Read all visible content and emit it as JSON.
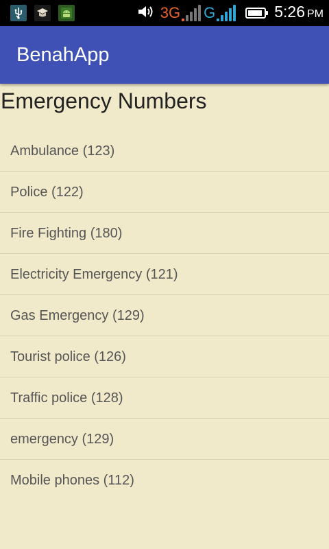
{
  "status_bar": {
    "network_label_1": "3G",
    "network_label_2": "G",
    "time": "5:26",
    "ampm": "PM",
    "icons": [
      "usb-icon",
      "hat-icon",
      "android-icon",
      "volume-icon",
      "signal-icon",
      "battery-icon"
    ]
  },
  "app_bar": {
    "title": "BenahApp"
  },
  "page": {
    "title": "Emergency Numbers"
  },
  "emergency_numbers": [
    {
      "label": "Ambulance (123)"
    },
    {
      "label": "Police (122)"
    },
    {
      "label": "Fire Fighting (180)"
    },
    {
      "label": "Electricity Emergency (121)"
    },
    {
      "label": "Gas Emergency (129)"
    },
    {
      "label": "Tourist police (126)"
    },
    {
      "label": "Traffic police (128)"
    },
    {
      "label": "emergency (129)"
    },
    {
      "label": "Mobile phones (112)"
    }
  ],
  "colors": {
    "app_bar": "#3f51b5",
    "background": "#f0eacb",
    "network_3g": "#e8632a",
    "network_g": "#2fa8d8"
  }
}
